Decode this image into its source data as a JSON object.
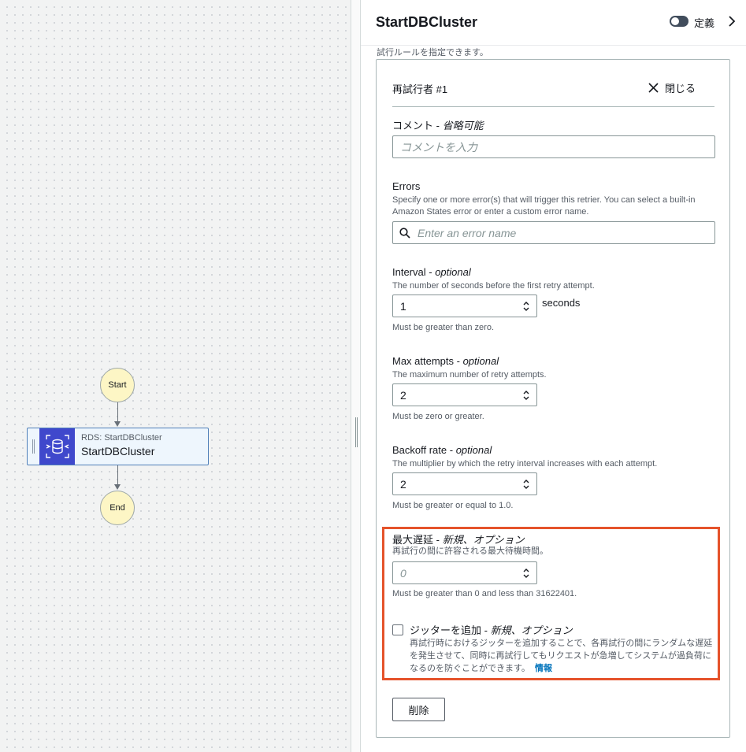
{
  "workflow": {
    "start_label": "Start",
    "end_label": "End",
    "task": {
      "service_label": "RDS: StartDBCluster",
      "name": "StartDBCluster"
    }
  },
  "panel": {
    "title": "StartDBCluster",
    "toggle_label": "定義",
    "truncated_text": "試行ルールを指定できます。",
    "retrier": {
      "heading": "再試行者 #1",
      "close_label": "閉じる",
      "comment": {
        "label": "コメント - ",
        "label_optional": "省略可能",
        "placeholder": "コメントを入力"
      },
      "errors": {
        "label": "Errors",
        "description": "Specify one or more error(s) that will trigger this retrier. You can select a built-in Amazon States error or enter a custom error name.",
        "placeholder": "Enter an error name"
      },
      "interval": {
        "label": "Interval - ",
        "label_optional": "optional",
        "description": "The number of seconds before the first retry attempt.",
        "value": "1",
        "suffix": "seconds",
        "constraint": "Must be greater than zero."
      },
      "max_attempts": {
        "label": "Max attempts - ",
        "label_optional": "optional",
        "description": "The maximum number of retry attempts.",
        "value": "2",
        "constraint": "Must be zero or greater."
      },
      "backoff_rate": {
        "label": "Backoff rate - ",
        "label_optional": "optional",
        "description": "The multiplier by which the retry interval increases with each attempt.",
        "value": "2",
        "constraint": "Must be greater or equal to 1.0."
      },
      "max_delay": {
        "label": "最大遅延 - ",
        "label_optional": "新規、オプション",
        "description": "再試行の間に許容される最大待機時間。",
        "placeholder": "0",
        "constraint": "Must be greater than 0 and less than 31622401."
      },
      "jitter": {
        "label": "ジッターを追加 - ",
        "label_optional": "新規、オプション",
        "description": "再試行時におけるジッターを追加することで、各再試行の間にランダムな遅延を発生させて、同時に再試行してもリクエストが急増してシステムが過負荷になるのを防ぐことができます。",
        "info_link": "情報",
        "checked": false
      },
      "delete_label": "削除"
    }
  },
  "colors": {
    "highlight": "#e5532b",
    "task_icon_bg": "#3f48cc",
    "link": "#0073bb"
  }
}
